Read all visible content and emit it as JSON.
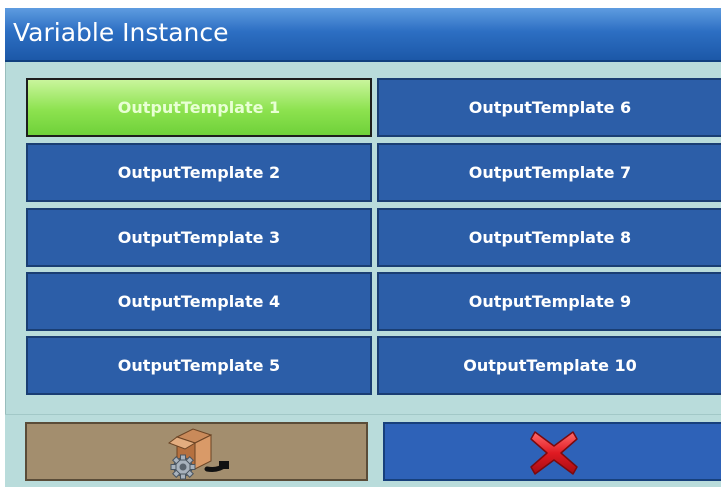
{
  "dialog": {
    "title": "Variable Instance"
  },
  "templates": [
    {
      "label": "OutputTemplate 1",
      "selected": true
    },
    {
      "label": "OutputTemplate 2",
      "selected": false
    },
    {
      "label": "OutputTemplate 3",
      "selected": false
    },
    {
      "label": "OutputTemplate 4",
      "selected": false
    },
    {
      "label": "OutputTemplate 5",
      "selected": false
    },
    {
      "label": "OutputTemplate 6",
      "selected": false
    },
    {
      "label": "OutputTemplate 7",
      "selected": false
    },
    {
      "label": "OutputTemplate 8",
      "selected": false
    },
    {
      "label": "OutputTemplate 9",
      "selected": false
    },
    {
      "label": "OutputTemplate 10",
      "selected": false
    }
  ],
  "softkeys": {
    "settings_icon": "box-gear-icon",
    "cancel_icon": "red-x-icon"
  },
  "colors": {
    "title_bar": "#2d6fc3",
    "button_blue": "#2c5ea8",
    "button_selected": "#8de24f",
    "panel_bg": "#b9dcdb",
    "settings_softkey": "#a38e6e",
    "cancel_icon": "#e0101c"
  }
}
